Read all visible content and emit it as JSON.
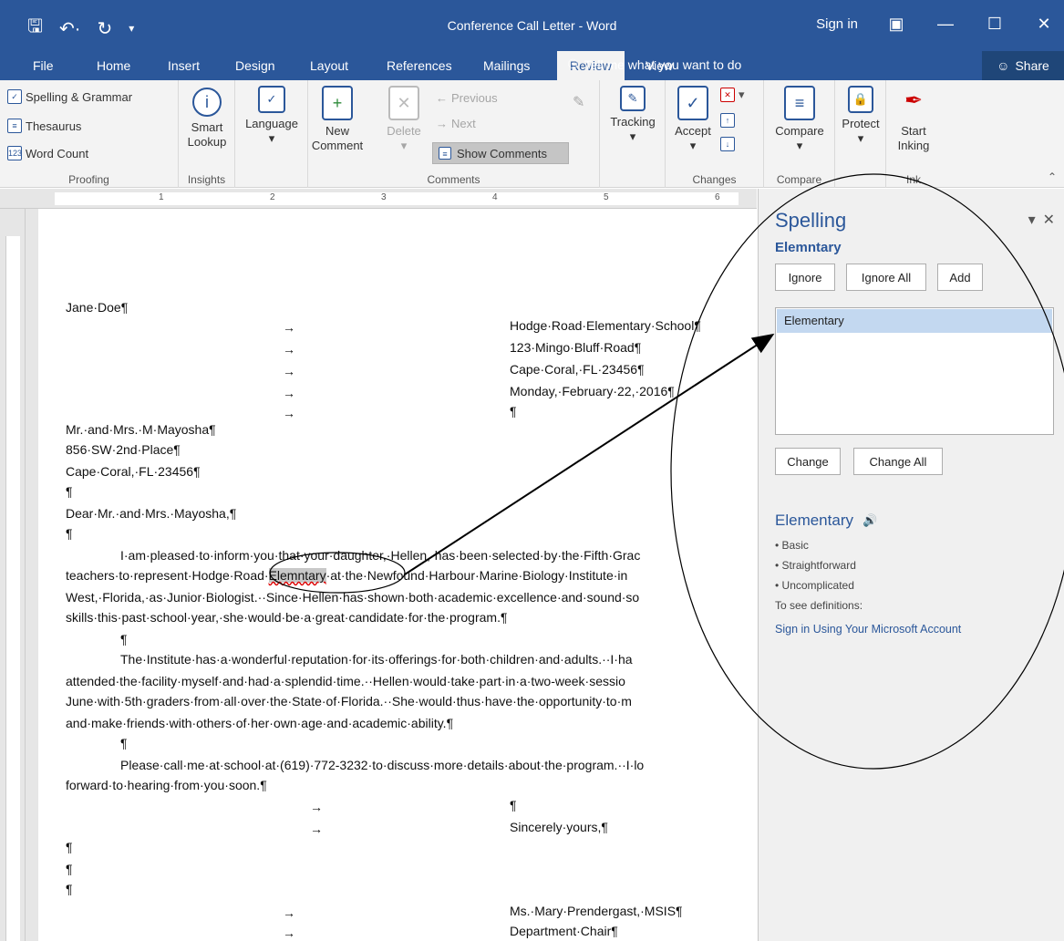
{
  "titlebar": {
    "title": "Conference Call Letter - Word",
    "sign_in": "Sign in",
    "save_icon": "save-icon",
    "undo_icon": "undo-icon",
    "redo_icon": "redo-icon"
  },
  "tabs": [
    "File",
    "Home",
    "Insert",
    "Design",
    "Layout",
    "References",
    "Mailings",
    "Review",
    "View"
  ],
  "active_tab": "Review",
  "tell_me": "Tell me what you want to do",
  "share": "Share",
  "ribbon": {
    "proofing": {
      "spelling": "Spelling & Grammar",
      "thesaurus": "Thesaurus",
      "word_count": "Word Count",
      "label": "Proofing"
    },
    "insights": {
      "smart_lookup_1": "Smart",
      "smart_lookup_2": "Lookup",
      "label": "Insights"
    },
    "language": {
      "language": "Language",
      "caret": "▾"
    },
    "comments": {
      "new_1": "New",
      "new_2": "Comment",
      "delete": "Delete",
      "previous": "Previous",
      "next": "Next",
      "show_comments": "Show Comments",
      "label": "Comments"
    },
    "tracking": {
      "tracking": "Tracking",
      "caret": "▾"
    },
    "changes": {
      "accept": "Accept",
      "caret": "▾",
      "label": "Changes"
    },
    "compare": {
      "compare": "Compare",
      "caret": "▾",
      "label": "Compare"
    },
    "protect": {
      "protect": "Protect",
      "caret": "▾"
    },
    "ink": {
      "start_1": "Start",
      "start_2": "Inking",
      "label": "Ink"
    }
  },
  "ruler": {
    "numbers": [
      "1",
      "2",
      "3",
      "4",
      "5",
      "6"
    ]
  },
  "document": {
    "lines": [
      "Jane·Doe¶",
      "Hodge·Road·Elementary·School¶",
      "123·Mingo·Bluff·Road¶",
      "Cape·Coral,·FL·23456¶",
      "Monday,·February·22,·2016¶",
      "¶",
      "Mr.·and·Mrs.·M·Mayosha¶",
      "856·SW·2nd·Place¶",
      "Cape·Coral,·FL·23456¶",
      "¶",
      "Dear·Mr.·and·Mrs.·Mayosha,¶",
      "¶",
      "I·am·pleased·to·inform·you·that·your·daughter,·Hellen,·has·been·selected·by·the·Fifth·Grac",
      "teachers·to·represent·Hodge·Road·",
      "Elemntary",
      "·at·the·Newfound·Harbour·Marine·Biology·Institute·in",
      "West,·Florida,·as·Junior·Biologist.··Since·Hellen·has·shown·both·academic·excellence·and·sound·so",
      "skills·this·past·school·year,·she·would·be·a·great·candidate·for·the·program.¶",
      "¶",
      "The·Institute·has·a·wonderful·reputation·for·its·offerings·for·both·children·and·adults.··I·ha",
      "attended·the·facility·myself·and·had·a·splendid·time.··Hellen·would·take·part·in·a·two-week·sessio",
      "June·with·5th·graders·from·all·over·the·State·of·Florida.··She·would·thus·have·the·opportunity·to·m",
      "and·make·friends·with·others·of·her·own·age·and·academic·ability.¶",
      "¶",
      "Please·call·me·at·school·at·(619)·772-3232·to·discuss·more·details·about·the·program.··I·lo",
      "forward·to·hearing·from·you·soon.¶",
      "¶",
      "Sincerely·yours,¶",
      "¶",
      "¶",
      "¶",
      "Ms.·Mary·Prendergast,·MSIS¶",
      "Department·Chair¶"
    ],
    "tab_arrow": "→"
  },
  "pane": {
    "title": "Spelling",
    "word": "Elemntary",
    "ignore": "Ignore",
    "ignore_all": "Ignore All",
    "add": "Add",
    "suggestion": "Elementary",
    "change": "Change",
    "change_all": "Change All",
    "def_word": "Elementary",
    "synonyms": [
      "• Basic",
      "• Straightforward",
      "• Uncomplicated"
    ],
    "see_defs": "To see definitions:",
    "sign_in_link": "Sign in Using Your Microsoft Account"
  }
}
